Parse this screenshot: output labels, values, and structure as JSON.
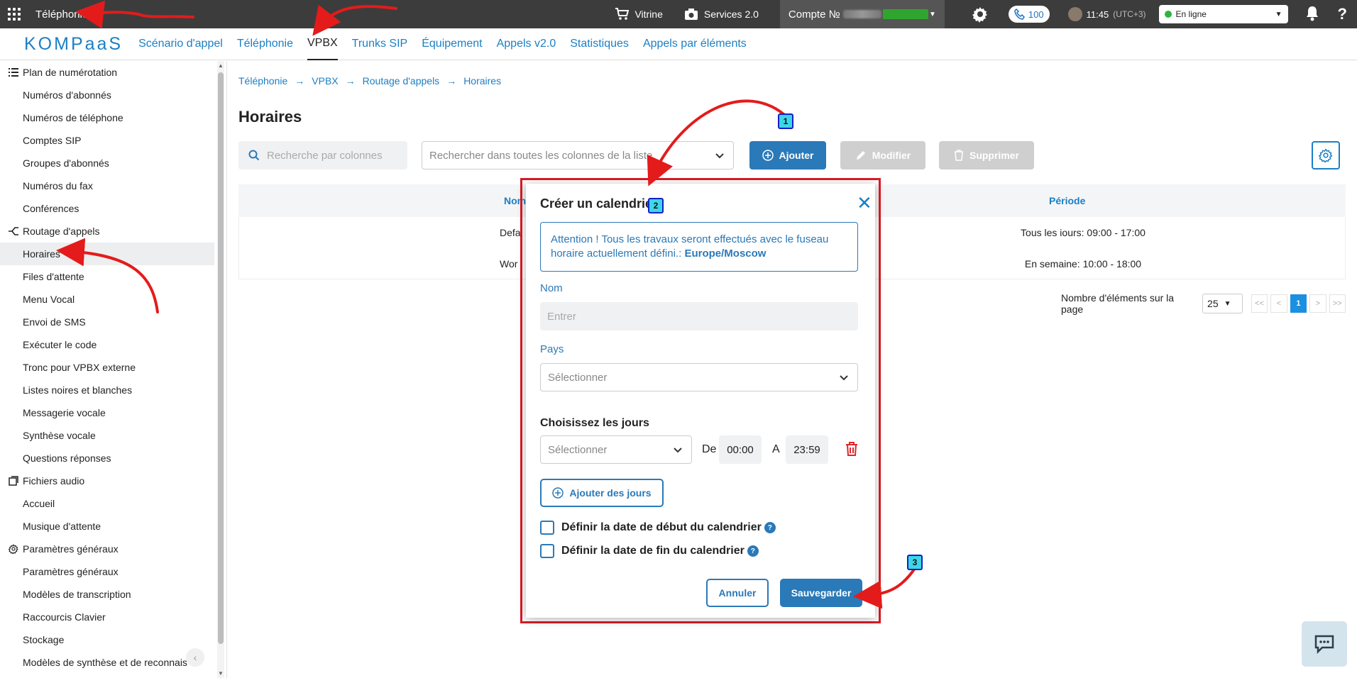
{
  "topbar": {
    "app_title": "Téléphonie",
    "vitrine": "Vitrine",
    "services": "Services 2.0",
    "account_label": "Compte №",
    "calls_count": "100",
    "time": "11:45",
    "timezone": "(UTC+3)",
    "status": "En ligne",
    "help": "?"
  },
  "nav": {
    "logo": "KOMPaaS",
    "items": [
      "Scénario d'appel",
      "Téléphonie",
      "VPBX",
      "Trunks SIP",
      "Équipement",
      "Appels v2.0",
      "Statistiques",
      "Appels par éléments"
    ],
    "active": "VPBX"
  },
  "sidebar": {
    "items": [
      {
        "label": "Plan de numérotation",
        "section": true,
        "icon": "list-icon"
      },
      {
        "label": "Numéros d'abonnés"
      },
      {
        "label": "Numéros de téléphone"
      },
      {
        "label": "Comptes SIP"
      },
      {
        "label": "Groupes d'abonnés"
      },
      {
        "label": "Numéros du fax"
      },
      {
        "label": "Conférences"
      },
      {
        "label": "Routage d'appels",
        "section": true,
        "icon": "routing-icon"
      },
      {
        "label": "Horaires",
        "active": true
      },
      {
        "label": "Files d'attente"
      },
      {
        "label": "Menu Vocal"
      },
      {
        "label": "Envoi de SMS"
      },
      {
        "label": "Exécuter le code"
      },
      {
        "label": "Tronc pour VPBX externe"
      },
      {
        "label": "Listes noires et blanches"
      },
      {
        "label": "Messagerie vocale"
      },
      {
        "label": "Synthèse vocale"
      },
      {
        "label": "Questions réponses"
      },
      {
        "label": "Fichiers audio",
        "section": true,
        "icon": "audio-file-icon"
      },
      {
        "label": "Accueil"
      },
      {
        "label": "Musique d'attente"
      },
      {
        "label": "Paramètres généraux",
        "section": true,
        "icon": "gear-icon"
      },
      {
        "label": "Paramètres généraux"
      },
      {
        "label": "Modèles de transcription"
      },
      {
        "label": "Raccourcis Clavier"
      },
      {
        "label": "Stockage"
      },
      {
        "label": "Modèles de synthèse et de reconnais"
      }
    ]
  },
  "main": {
    "breadcrumb": [
      "Téléphonie",
      "VPBX",
      "Routage d'appels",
      "Horaires"
    ],
    "title": "Horaires",
    "search_placeholder": "Recherche par colonnes",
    "search_all_placeholder": "Rechercher dans toutes les colonnes de la liste",
    "add_label": "Ajouter",
    "edit_label": "Modifier",
    "delete_label": "Supprimer",
    "columns": [
      "Nom",
      "Période"
    ],
    "rows": [
      {
        "name": "Defa",
        "period": "Tous les iours: 09:00 - 17:00"
      },
      {
        "name": "Wor",
        "period": "En semaine: 10:00 - 18:00"
      }
    ],
    "pager": {
      "label": "Nombre d'éléments sur la page",
      "page_size": "25",
      "first": "<<",
      "prev": "<",
      "current": "1",
      "next": ">",
      "last": ">>"
    }
  },
  "modal": {
    "title": "Créer un calendrier",
    "alert_text": "Attention ! Tous les travaux seront effectués avec le fuseau horaire actuellement défini.:",
    "alert_tz": "Europe/Moscow",
    "name_label": "Nom",
    "name_placeholder": "Entrer",
    "country_label": "Pays",
    "country_placeholder": "Sélectionner",
    "days_title": "Choisissez les jours",
    "day_placeholder": "Sélectionner",
    "from_label": "De",
    "from_time": "00:00",
    "to_label": "A",
    "to_time": "23:59",
    "add_days_label": "Ajouter des jours",
    "start_date_label": "Définir la date de début du calendrier",
    "end_date_label": "Définir la date de fin du calendrier",
    "cancel_label": "Annuler",
    "save_label": "Sauvegarder"
  },
  "annotations": [
    "1",
    "2",
    "3"
  ],
  "colors": {
    "accent": "#2a79b8",
    "link": "#1b7fc4",
    "topbar": "#3c3c3c",
    "annotation_arrow": "#e41b1b",
    "highlight_frame": "#d81c24"
  }
}
